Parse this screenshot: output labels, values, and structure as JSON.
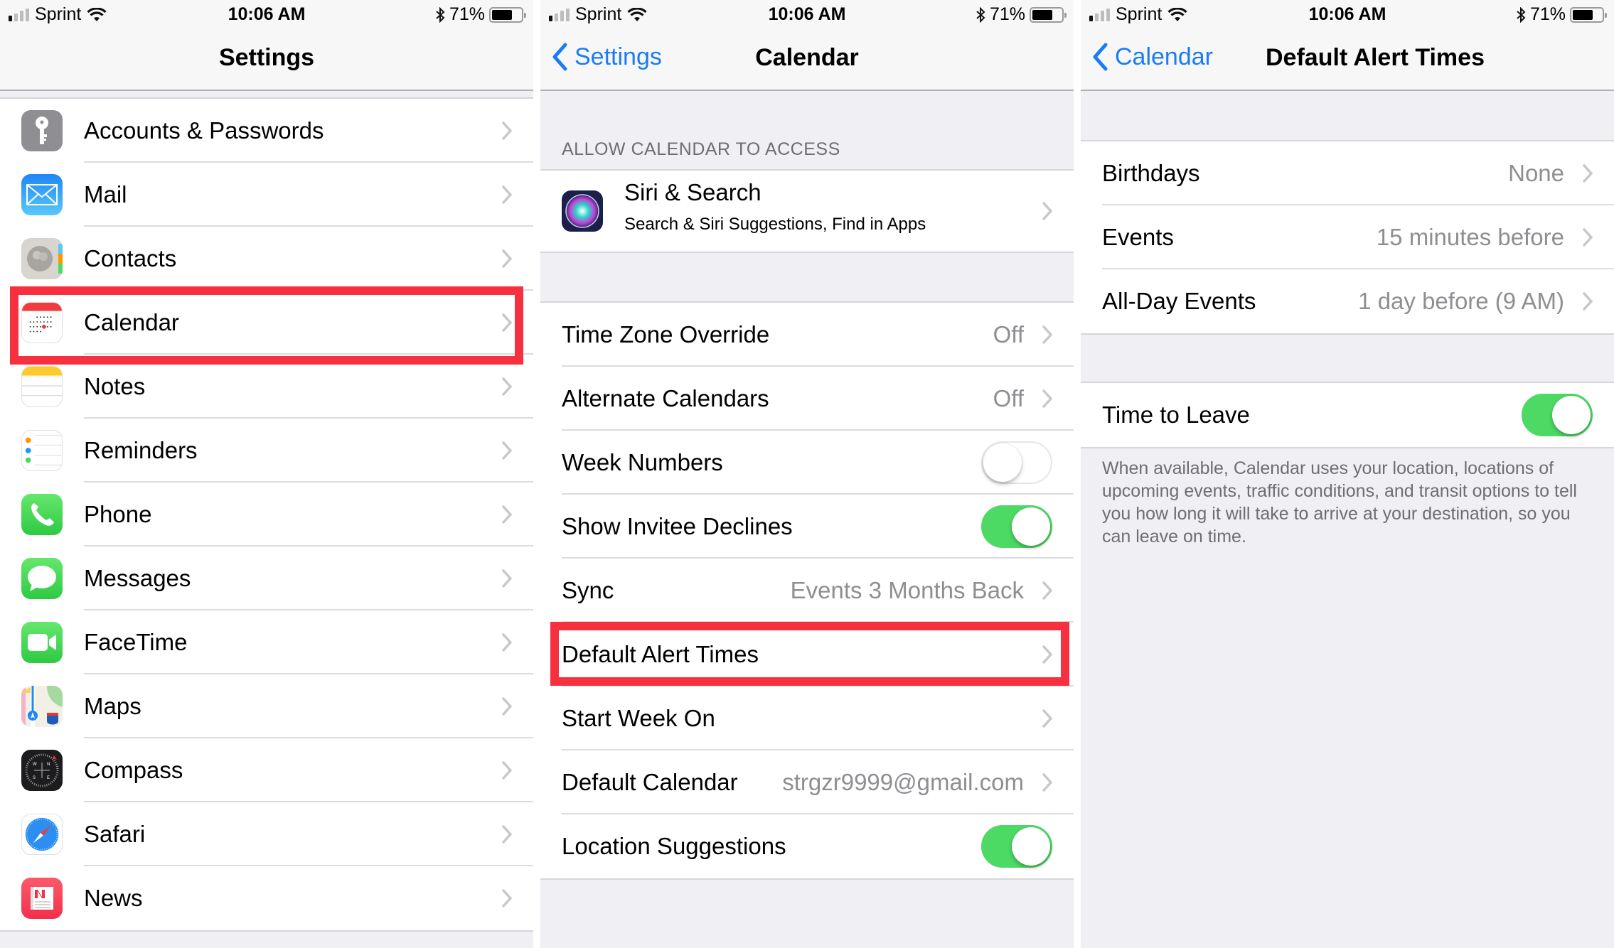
{
  "status_bar": {
    "carrier": "Sprint",
    "time": "10:06 AM",
    "battery_percent": "71%",
    "battery_level": 0.71,
    "signal_bars_active": 1,
    "signal_bars_total": 4
  },
  "colors": {
    "accent_blue": "#1a7cf5",
    "toggle_on": "#4cd964",
    "highlight_red": "#f7303f",
    "secondary_text": "#8e8e93"
  },
  "panel1": {
    "title": "Settings",
    "items": [
      {
        "label": "Accounts & Passwords",
        "icon": "key-icon"
      },
      {
        "label": "Mail",
        "icon": "mail-icon"
      },
      {
        "label": "Contacts",
        "icon": "contacts-icon"
      },
      {
        "label": "Calendar",
        "icon": "calendar-icon",
        "highlighted": true
      },
      {
        "label": "Notes",
        "icon": "notes-icon"
      },
      {
        "label": "Reminders",
        "icon": "reminders-icon"
      },
      {
        "label": "Phone",
        "icon": "phone-icon"
      },
      {
        "label": "Messages",
        "icon": "messages-icon"
      },
      {
        "label": "FaceTime",
        "icon": "facetime-icon"
      },
      {
        "label": "Maps",
        "icon": "maps-icon"
      },
      {
        "label": "Compass",
        "icon": "compass-icon"
      },
      {
        "label": "Safari",
        "icon": "safari-icon"
      },
      {
        "label": "News",
        "icon": "news-icon"
      }
    ]
  },
  "panel2": {
    "back_label": "Settings",
    "title": "Calendar",
    "section_header": "ALLOW CALENDAR TO ACCESS",
    "siri": {
      "title": "Siri & Search",
      "subtitle": "Search & Siri Suggestions, Find in Apps",
      "icon": "siri-icon"
    },
    "items": [
      {
        "label": "Time Zone Override",
        "value": "Off",
        "type": "disclosure"
      },
      {
        "label": "Alternate Calendars",
        "value": "Off",
        "type": "disclosure"
      },
      {
        "label": "Week Numbers",
        "type": "toggle",
        "on": false
      },
      {
        "label": "Show Invitee Declines",
        "type": "toggle",
        "on": true
      },
      {
        "label": "Sync",
        "value": "Events 3 Months Back",
        "type": "disclosure"
      },
      {
        "label": "Default Alert Times",
        "value": "",
        "type": "disclosure",
        "highlighted": true
      },
      {
        "label": "Start Week On",
        "value": "",
        "type": "disclosure"
      },
      {
        "label": "Default Calendar",
        "value": "strgzr9999@gmail.com",
        "type": "disclosure"
      },
      {
        "label": "Location Suggestions",
        "type": "toggle",
        "on": true
      }
    ]
  },
  "panel3": {
    "back_label": "Calendar",
    "title": "Default Alert Times",
    "alerts": [
      {
        "label": "Birthdays",
        "value": "None"
      },
      {
        "label": "Events",
        "value": "15 minutes before"
      },
      {
        "label": "All-Day Events",
        "value": "1 day before (9 AM)"
      }
    ],
    "time_to_leave": {
      "label": "Time to Leave",
      "on": true
    },
    "footer": "When available, Calendar uses your location, locations of upcoming events, traffic conditions, and transit options to tell you how long it will take to arrive at your destination, so you can leave on time."
  }
}
